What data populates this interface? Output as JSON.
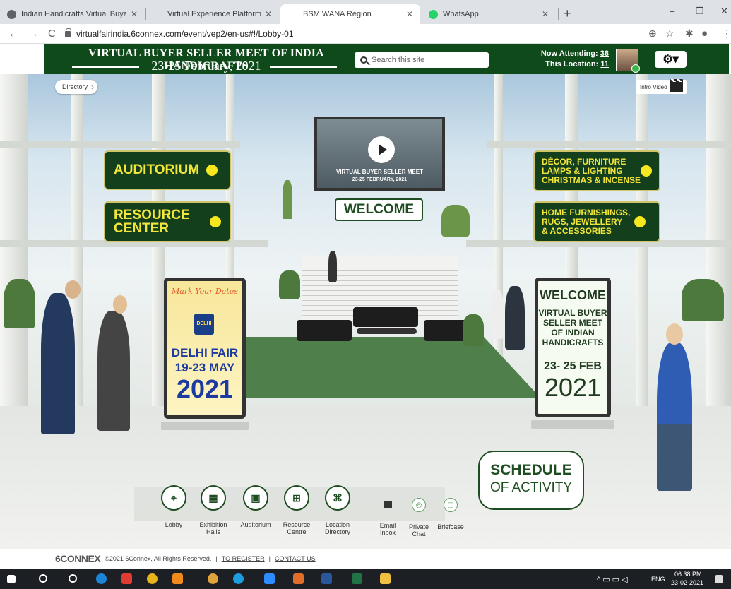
{
  "browser": {
    "tabs": [
      {
        "title": "Indian Handicrafts Virtual Buyer-",
        "active": false,
        "favicon": "globe-icon"
      },
      {
        "title": "Virtual Experience Platform Cont",
        "active": false,
        "favicon": "none"
      },
      {
        "title": "BSM WANA Region",
        "active": true,
        "favicon": "none"
      },
      {
        "title": "WhatsApp",
        "active": false,
        "favicon": "whatsapp-icon"
      }
    ],
    "new_tab": "+",
    "url": "virtualfairindia.6connex.com/event/vep2/en-us#!/Lobby-01",
    "window_controls": {
      "minimize": "–",
      "restore": "❐",
      "close": "✕"
    }
  },
  "header": {
    "title": "VIRTUAL BUYER SELLER MEET OF INDIA HANDICRAFTS",
    "dates": "23-25 February, 2021",
    "search_placeholder": "Search this site",
    "now_attending_label": "Now Attending:",
    "now_attending_count": "38",
    "this_location_label": "This Location:",
    "this_location_count": "11",
    "settings_glyph": "⚙▾"
  },
  "scene": {
    "directory_label": "Directory",
    "intro_video_label": "Intro Video",
    "video": {
      "line1": "VIRTUAL BUYER SELLER MEET",
      "line2": "23-25 FEBRUARY, 2021"
    },
    "welcome_sign": "WELCOME",
    "hall_buttons": {
      "auditorium": "AUDITORIUM",
      "resource_center": "RESOURCE\nCENTER",
      "decor": "DÉCOR, FURNITURE\nLAMPS & LIGHTING\nCHRISTMAS & INCENSE",
      "home": "HOME FURNISHINGS,\nRUGS, JEWELLERY\n& ACCESSORIES"
    },
    "left_standee": {
      "mark_dates": "Mark Your Dates",
      "logo_text": "DELHI",
      "name": "DELHI FAIR",
      "dates": "19-23 MAY",
      "year": "2021"
    },
    "right_standee": {
      "welcome": "WELCOME",
      "line1": "VIRTUAL BUYER",
      "line2": "SELLER MEET",
      "line3": "OF INDIAN",
      "line4": "HANDICRAFTS",
      "dates": "23- 25 FEB",
      "year": "2021"
    },
    "schedule": {
      "line1": "SCHEDULE",
      "line2": "OF ACTIVITY"
    }
  },
  "bottom_nav": [
    {
      "label": "Lobby",
      "icon": "location-pin-icon",
      "glyph": "⌖"
    },
    {
      "label": "Exhibition\nHalls",
      "icon": "building-icon",
      "glyph": "▦"
    },
    {
      "label": "Auditorium",
      "icon": "auditorium-icon",
      "glyph": "▣"
    },
    {
      "label": "Resource\nCentre",
      "icon": "resource-icon",
      "glyph": "⊞"
    },
    {
      "label": "Location\nDirectory",
      "icon": "map-icon",
      "glyph": "⌘"
    }
  ],
  "secondary_nav": [
    {
      "label": "Email\nInbox",
      "icon": "email-icon"
    },
    {
      "label": "Private\nChat",
      "icon": "chat-icon",
      "glyph": "◎"
    },
    {
      "label": "Briefcase",
      "icon": "briefcase-icon",
      "glyph": "▢"
    }
  ],
  "footer": {
    "brand": "6CONNEX",
    "copyright": "©2021 6Connex, All Rights Reserved.",
    "sep": "|",
    "register": "TO REGISTER",
    "contact": "CONTACT US"
  },
  "taskbar": {
    "time": "06:38 PM",
    "date": "23-02-2021",
    "lang": "ENG"
  },
  "colors": {
    "header_green": "#0f4a1a",
    "button_yellow": "#f2e63b",
    "accent_green": "#1f4d22"
  }
}
